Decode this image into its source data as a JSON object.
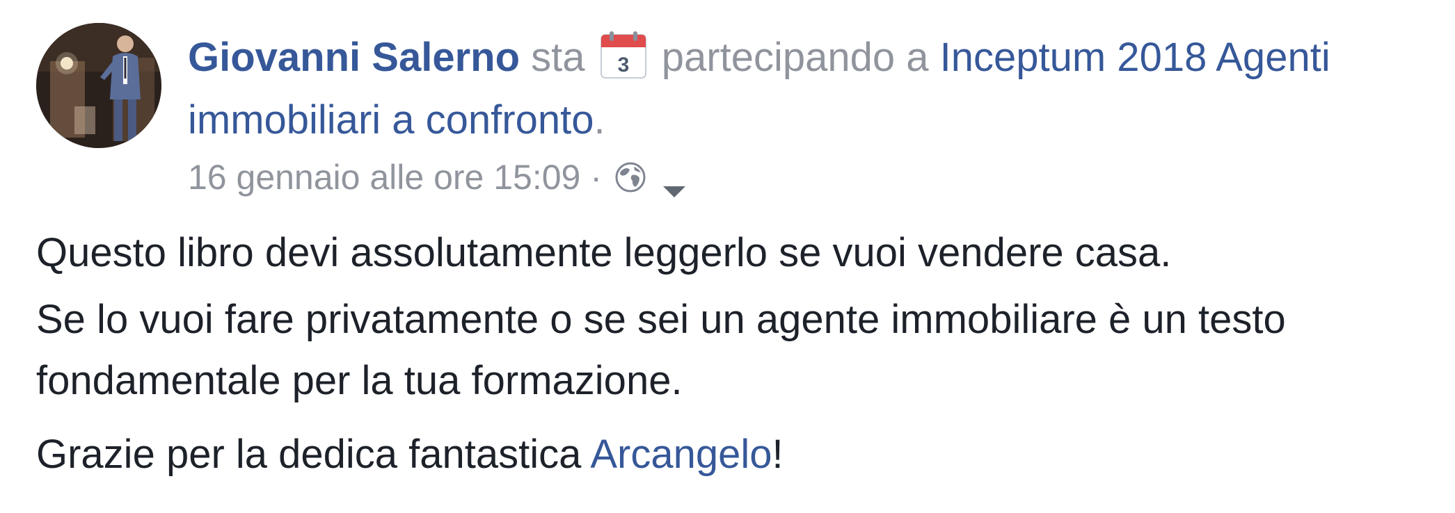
{
  "post": {
    "author": "Giovanni Salerno",
    "activity_verb": "sta",
    "calendar_icon": "calendar-icon",
    "calendar_day": "3",
    "activity_phrase": "partecipando a",
    "event_name": "Inceptum 2018 Agenti immobiliari a confronto",
    "event_suffix": ".",
    "timestamp": "16 gennaio alle ore 15:09",
    "separator": "·",
    "privacy_icon": "globe-icon",
    "menu_icon": "chevron-down-icon",
    "paragraphs": {
      "p1": "Questo libro devi assolutamente leggerlo se vuoi vendere casa.",
      "p2": "Se lo vuoi fare privatamente o se sei un agente immobiliare è un testo fondamentale per la tua formazione.",
      "p3_prefix": "Grazie per la dedica fantastica ",
      "p3_mention": "Arcangelo",
      "p3_suffix": "!"
    }
  },
  "colors": {
    "link": "#365899",
    "meta": "#90949c",
    "text": "#1d2129",
    "calendar_red": "#e04b4b"
  }
}
